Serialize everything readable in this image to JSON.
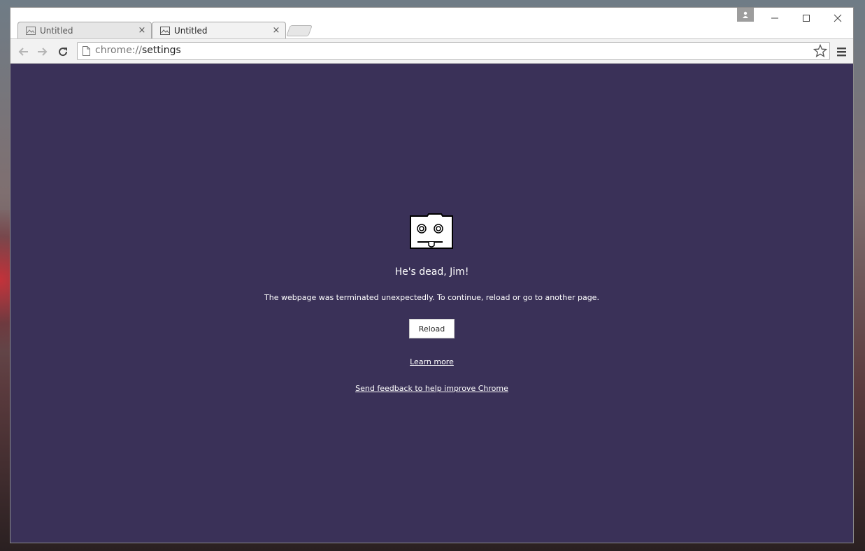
{
  "tabs": [
    {
      "label": "Untitled",
      "active": false,
      "close": "×"
    },
    {
      "label": "Untitled",
      "active": true,
      "close": "×"
    }
  ],
  "omnibox": {
    "scheme": "chrome://",
    "host": "settings"
  },
  "crash_page": {
    "title": "He's dead, Jim!",
    "message": "The webpage was terminated unexpectedly. To continue, reload or go to another page.",
    "reload_label": "Reload",
    "learn_more": "Learn more",
    "feedback": "Send feedback to help improve Chrome"
  },
  "colors": {
    "page_background": "#3a3158",
    "chrome_frame": "#f2f2f2"
  },
  "icons": {
    "sad_tab": "dead-face-icon",
    "back": "back-arrow-icon",
    "forward": "forward-arrow-icon",
    "reload": "reload-icon",
    "bookmark": "star-icon",
    "menu": "hamburger-menu-icon"
  }
}
